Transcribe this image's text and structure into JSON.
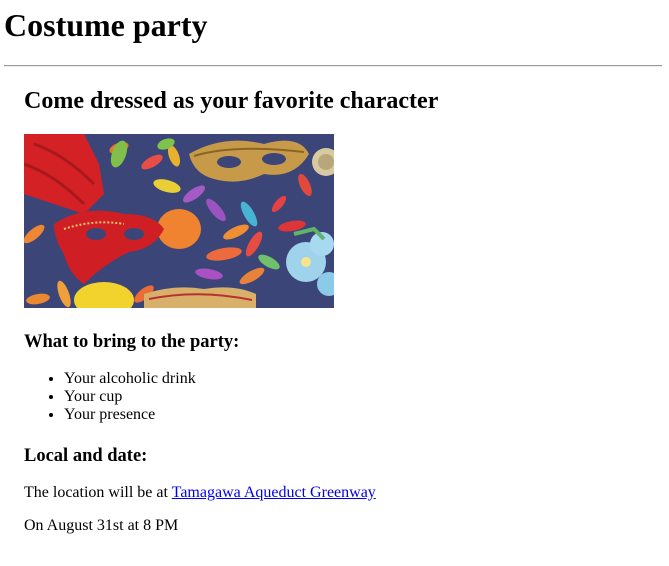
{
  "page": {
    "title": "Costume party"
  },
  "main": {
    "heading": "Come dressed as your favorite character",
    "image_icon": "costume-party-photo",
    "bring": {
      "heading": "What to bring to the party:",
      "items": [
        "Your alcoholic drink",
        "Your cup",
        "Your presence"
      ]
    },
    "local": {
      "heading": "Local and date:",
      "location_prefix": "The location will be at ",
      "location_link": "Tamagawa Aqueduct Greenway",
      "date": "On August 31st at 8 PM"
    }
  },
  "colors": {
    "link": "#0000ee",
    "divider": "#9a9a9a",
    "image_background": "#3c4577"
  }
}
